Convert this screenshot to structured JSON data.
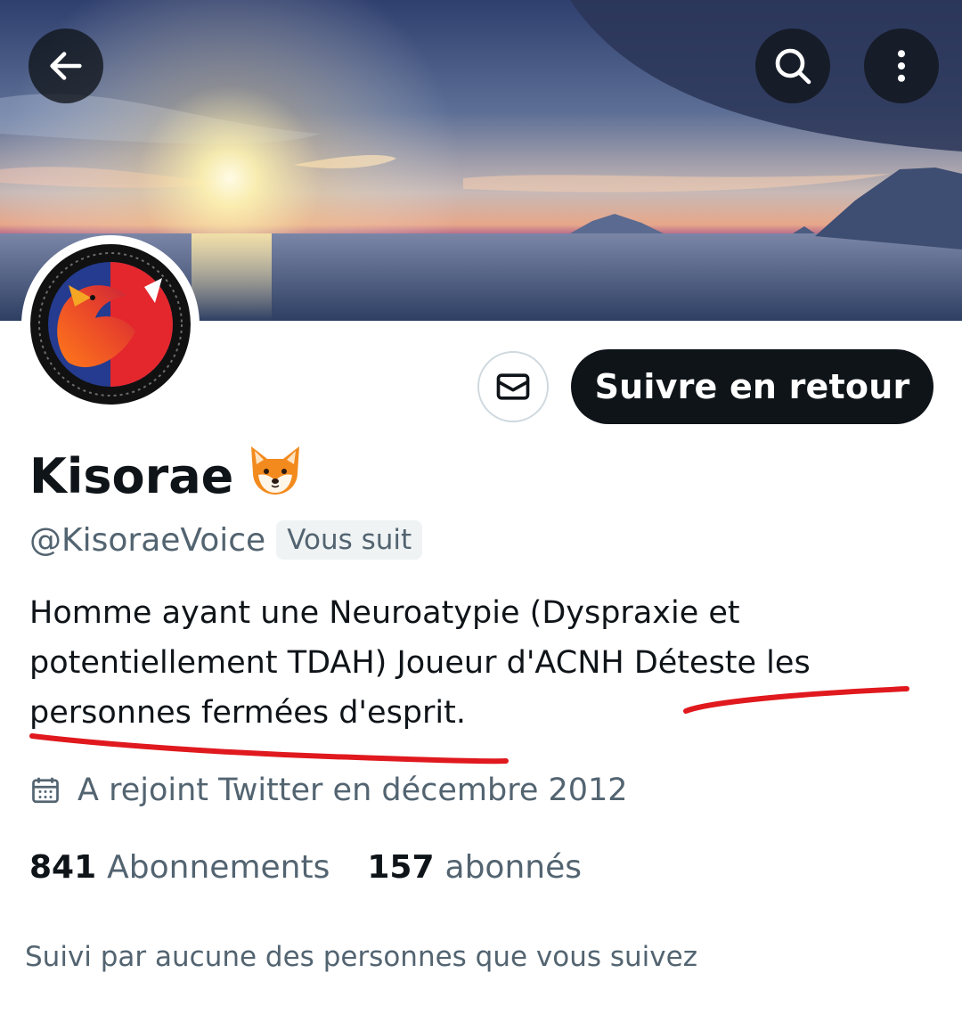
{
  "header": {
    "back_icon": "arrow-left-icon",
    "search_icon": "search-icon",
    "more_icon": "more-vertical-icon"
  },
  "profile": {
    "display_name": "Kisorae",
    "name_emoji": "fox-face-emoji",
    "handle": "@KisoraeVoice",
    "follows_you_badge": "Vous suit",
    "bio_lines": [
      "Homme ayant une Neuroatypie (Dyspraxie et",
      "potentiellement TDAH) Joueur d'ACNH Déteste les",
      "personnes fermées d'esprit."
    ],
    "joined": "A rejoint Twitter en décembre 2012",
    "following_count": "841",
    "following_label": "Abonnements",
    "followers_count": "157",
    "followers_label": "abonnés",
    "followed_by_text": "Suivi par aucune des personnes que vous suivez"
  },
  "actions": {
    "message_icon": "envelope-icon",
    "follow_back_label": "Suivre en retour"
  },
  "colors": {
    "primary_text": "#0f1419",
    "secondary_text": "#536471",
    "follow_button_bg": "#0f1419",
    "annotation_red": "#e0191e"
  }
}
